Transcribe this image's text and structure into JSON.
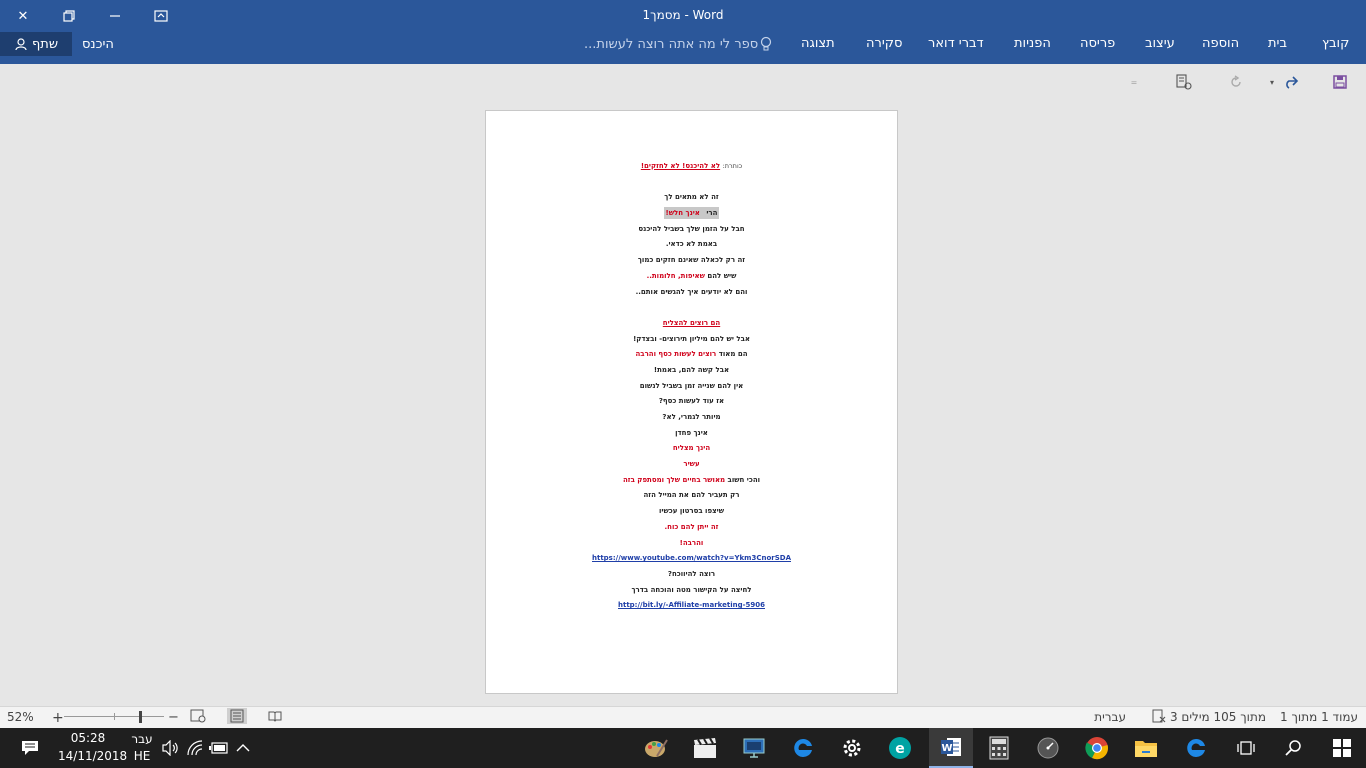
{
  "window": {
    "title": "מסמך1 - Word",
    "close_label": "✕",
    "restore_label": "🗗",
    "minimize_label": "—",
    "ribbon_display_label": "⇱"
  },
  "ribbon": {
    "tabs": [
      "קובץ",
      "בית",
      "הוספה",
      "עיצוב",
      "פריסה",
      "הפניות",
      "דברי דואר",
      "סקירה",
      "תצוגה"
    ],
    "tell_me": "ספר לי מה אתה רוצה לעשות...",
    "sign_in": "היכנס",
    "share": "שתף"
  },
  "document": {
    "header_label": "כותרת:",
    "header_text": "לא להיכנס! לא לחזקים!",
    "lines": [
      {
        "parts": [
          {
            "t": "זה לא מתאים לך"
          }
        ]
      },
      {
        "parts": [
          {
            "t": "הרי ",
            "hl": true
          },
          {
            "t": "אינך חלש!",
            "red": true,
            "hl": true
          }
        ]
      },
      {
        "parts": [
          {
            "t": "חבל על הזמן שלך בשביל להיכנס"
          }
        ]
      },
      {
        "parts": [
          {
            "t": "באמת לא כדאי."
          }
        ]
      },
      {
        "parts": [
          {
            "t": "זה רק לכאלה שאינם חזקים כמוך"
          }
        ]
      },
      {
        "parts": [
          {
            "t": "שיש להם "
          },
          {
            "t": "שאיפות, חלומות..",
            "red": true
          }
        ]
      },
      {
        "parts": [
          {
            "t": "והם לא יודעים איך להגשים אותם.."
          }
        ]
      },
      {
        "gap": true
      },
      {
        "parts": [
          {
            "t": "הם רוצים להצליח",
            "red": true,
            "ul": true
          }
        ]
      },
      {
        "parts": [
          {
            "t": "אבל יש להם מיליון תירוצים- ובצדק!"
          }
        ]
      },
      {
        "parts": [
          {
            "t": "הם מאוד "
          },
          {
            "t": "רוצים לעשות כסף והרבה",
            "red": true
          }
        ]
      },
      {
        "parts": [
          {
            "t": "אבל קשה להם, באמת!"
          }
        ]
      },
      {
        "parts": [
          {
            "t": "אין להם שנייה זמן בשביל לנשום"
          }
        ]
      },
      {
        "parts": [
          {
            "t": "אז עוד לעשות כסף?"
          }
        ]
      },
      {
        "parts": [
          {
            "t": "מיותר לגמרי, לא?"
          }
        ]
      },
      {
        "parts": [
          {
            "t": "אינך פחדן"
          }
        ]
      },
      {
        "parts": [
          {
            "t": "הינך מצליח",
            "red": true
          }
        ]
      },
      {
        "parts": [
          {
            "t": "עשיר",
            "red": true
          }
        ]
      },
      {
        "parts": [
          {
            "t": "והכי חשוב "
          },
          {
            "t": "מאושר בחיים שלך ומסתפק בזה",
            "red": true
          }
        ]
      },
      {
        "parts": [
          {
            "t": "רק תעביר להם את המייל הזה"
          }
        ]
      },
      {
        "parts": [
          {
            "t": "שיצפו בסרטון עכשיו"
          }
        ]
      },
      {
        "parts": [
          {
            "t": "זה ייתן להם כוח.",
            "red": true
          }
        ]
      },
      {
        "parts": [
          {
            "t": "והרבה!",
            "red": true
          }
        ]
      },
      {
        "parts": [
          {
            "t": "https://www.youtube.com/watch?v=Ykm3CnorSDA",
            "link": true
          }
        ]
      },
      {
        "parts": [
          {
            "t": "רוצה להיווכח?"
          }
        ]
      },
      {
        "parts": [
          {
            "t": "לחיצה על הקישור מטה והוכחה בדרך"
          }
        ]
      },
      {
        "parts": [
          {
            "t": "http://bit.ly/-Affiliate-marketing-5906",
            "link": true
          }
        ]
      }
    ]
  },
  "status": {
    "page": "עמוד 1 מתוך 1",
    "words": "3 מתוך 105 מילים",
    "language": "עברית",
    "zoom": "52%",
    "zoom_level": 0.52
  },
  "taskbar": {
    "time": "05:28",
    "date": "14/11/2018",
    "lang_top": "עבר",
    "lang_bottom": "HE"
  },
  "colors": {
    "accent": "#2b579a",
    "highlight_red": "#d0021b",
    "link": "#1f3fa8"
  }
}
